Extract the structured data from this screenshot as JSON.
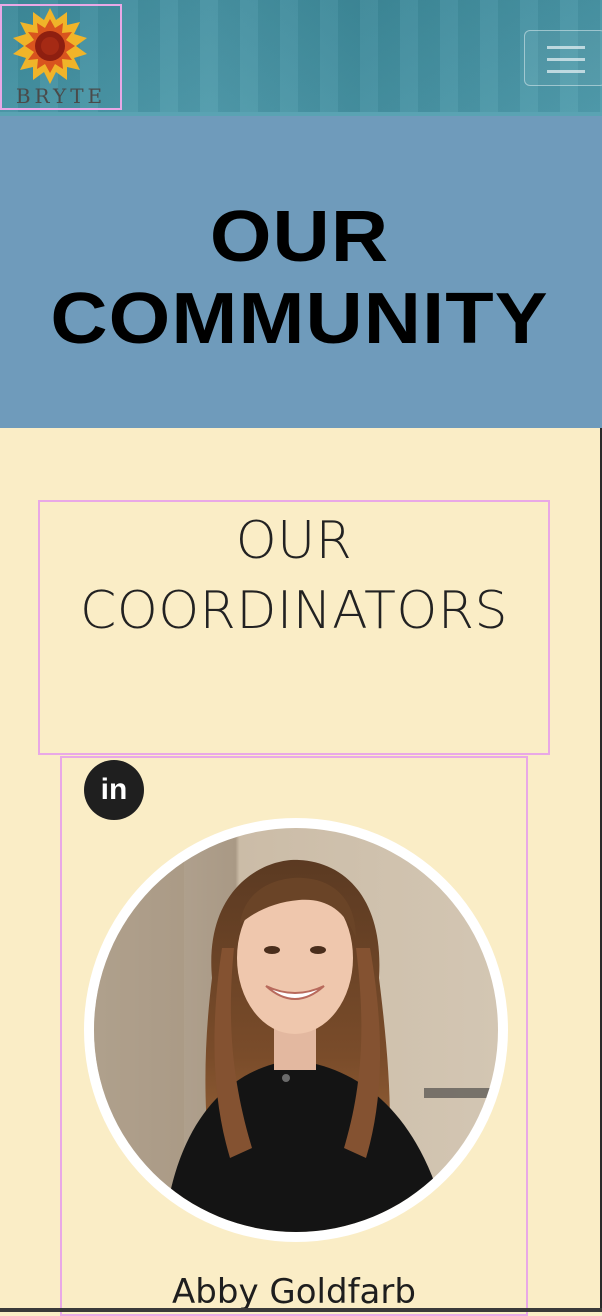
{
  "header": {
    "logo_text": "BRYTE",
    "logo_icon": "sunflower-icon",
    "menu_icon": "hamburger-menu-icon"
  },
  "hero": {
    "title_line1": "OUR",
    "title_line2": "COMMUNITY"
  },
  "coordinators": {
    "heading_line1": "OUR",
    "heading_line2": "COORDINATORS",
    "members": [
      {
        "name": "Abby Goldfarb",
        "social_icon": "linkedin-icon",
        "social_label": "in"
      }
    ]
  },
  "colors": {
    "navbar": "#4496a7",
    "hero_background": "#6f9bbb",
    "section_background": "#faedc6",
    "text_dark": "#222222"
  }
}
